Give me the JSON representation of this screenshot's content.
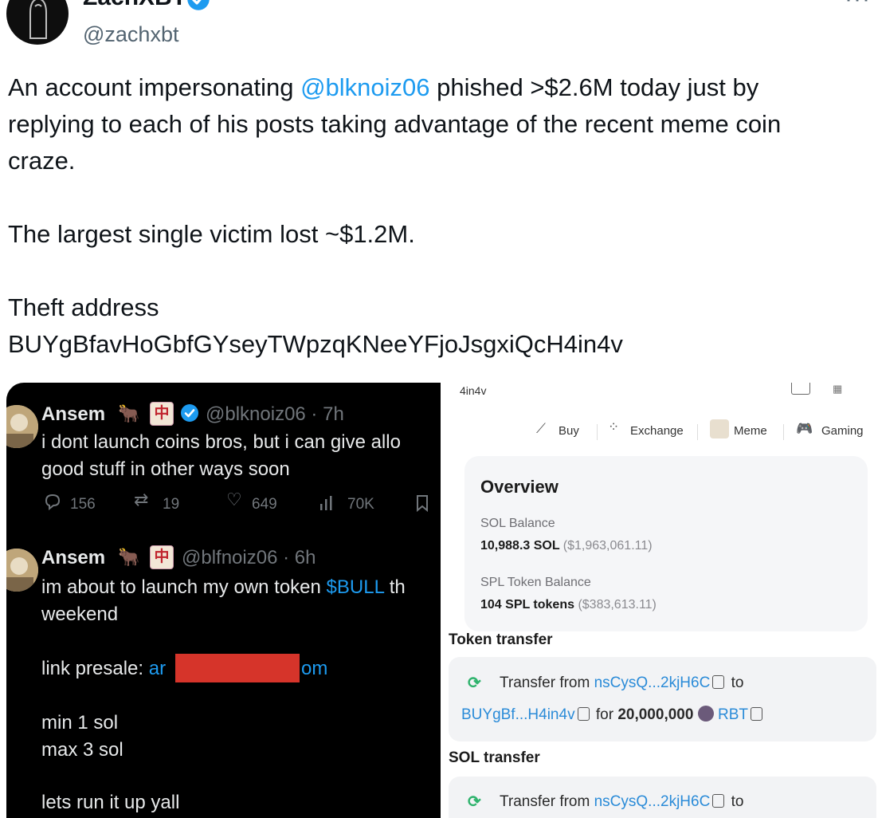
{
  "tweet": {
    "author_name": "ZachXBT",
    "handle": "@zachxbt",
    "more_icon": "more-dots-icon",
    "text": {
      "line1_prefix": "An account impersonating ",
      "line1_mention": "@blknoiz06",
      "line1_suffix": " phished >$2.6M today just by",
      "line2": "replying to each of his posts taking advantage of the recent meme coin",
      "line3": "craze.",
      "line4": "The largest single victim lost ~$1.2M.",
      "line5": "Theft address",
      "line6": "BUYgBfavHoGbfGYseyTWpzqKNeeYFjoJsgxiQcH4in4v"
    }
  },
  "embedded_left": {
    "post1": {
      "name": "Ansem",
      "handle_time": "@blknoiz06 · 7h",
      "line1": "i dont launch coins bros, but i can give allo",
      "line2": "good stuff in other ways soon",
      "replies": "156",
      "reposts": "19",
      "likes": "649",
      "views": "70K"
    },
    "post2": {
      "name": "Ansem",
      "handle_time": "@blfnoiz06 · 6h",
      "line1_prefix": "im about to launch my own token ",
      "line1_token": "$BULL",
      "line1_suffix": " th",
      "line2": "weekend",
      "line3_prefix": "link presale: ",
      "line3_a": "ar",
      "line3_b": "om",
      "line4": "min 1 sol",
      "line5": "max 3 sol",
      "line6": "lets run it up yall"
    }
  },
  "embedded_right": {
    "top_partial": "4in4v",
    "tabs": [
      {
        "label": "Buy",
        "icon": "buy-tag-icon"
      },
      {
        "label": "Exchange",
        "icon": "exchange-icon"
      },
      {
        "label": "Meme",
        "icon": "meme-dog-icon"
      },
      {
        "label": "Gaming",
        "icon": "gamepad-icon"
      }
    ],
    "overview": {
      "title": "Overview",
      "sol_label": "SOL Balance",
      "sol_value": "10,988.3 SOL",
      "sol_usd": "($1,963,061.11)",
      "spl_label": "SPL Token Balance",
      "spl_value": "104 SPL tokens",
      "spl_usd": "($383,613.11)"
    },
    "token_transfer": {
      "title": "Token transfer",
      "text1": "Transfer from ",
      "from": "nsCysQ...2kjH6C",
      "to_word": "to",
      "to": "BUYgBf...H4in4v",
      "for_word": "for",
      "amount": "20,000,000",
      "token": "RBT"
    },
    "sol_transfer": {
      "title": "SOL transfer",
      "text1": "Transfer from ",
      "from": "nsCysQ...2kjH6C",
      "to_word": "to"
    }
  },
  "colors": {
    "link_blue": "#1d9bf0",
    "dark_bg": "#000000",
    "redaction": "#d6342a",
    "solscan_link": "#2a8bd8"
  }
}
